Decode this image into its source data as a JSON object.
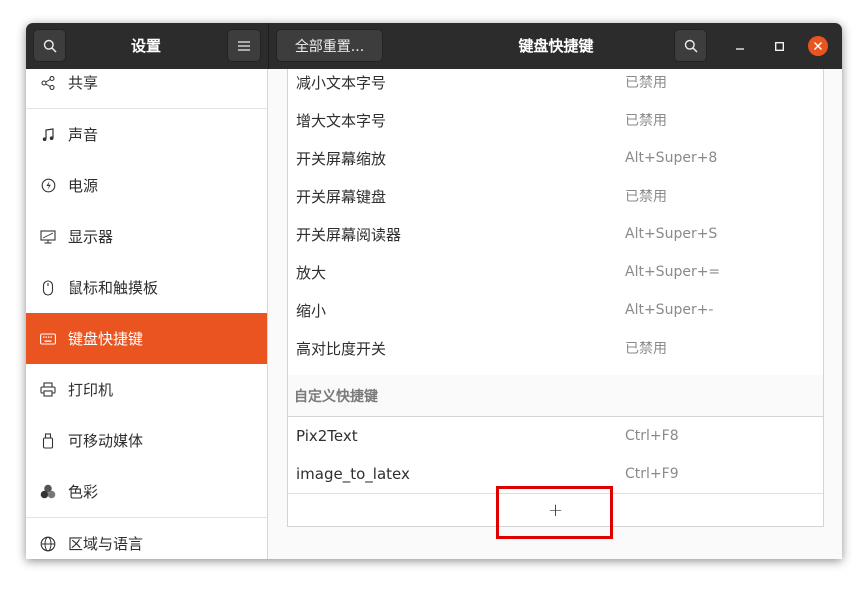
{
  "header": {
    "sidebar_title": "设置",
    "reset_button_label": "全部重置...",
    "page_title": "键盘快捷键"
  },
  "sidebar": {
    "items": [
      {
        "label": "共享",
        "icon": "share-icon"
      },
      {
        "label": "声音",
        "icon": "music-note-icon"
      },
      {
        "label": "电源",
        "icon": "power-icon"
      },
      {
        "label": "显示器",
        "icon": "display-icon"
      },
      {
        "label": "鼠标和触摸板",
        "icon": "mouse-icon"
      },
      {
        "label": "键盘快捷键",
        "icon": "keyboard-icon",
        "active": true
      },
      {
        "label": "打印机",
        "icon": "printer-icon"
      },
      {
        "label": "可移动媒体",
        "icon": "removable-media-icon"
      },
      {
        "label": "色彩",
        "icon": "color-icon"
      },
      {
        "label": "区域与语言",
        "icon": "globe-icon"
      }
    ]
  },
  "shortcuts": {
    "rows": [
      {
        "name": "减小文本字号",
        "accel": "已禁用"
      },
      {
        "name": "增大文本字号",
        "accel": "已禁用"
      },
      {
        "name": "开关屏幕缩放",
        "accel": "Alt+Super+8"
      },
      {
        "name": "开关屏幕键盘",
        "accel": "已禁用"
      },
      {
        "name": "开关屏幕阅读器",
        "accel": "Alt+Super+S"
      },
      {
        "name": "放大",
        "accel": "Alt+Super+="
      },
      {
        "name": "缩小",
        "accel": "Alt+Super+-"
      },
      {
        "name": "高对比度开关",
        "accel": "已禁用"
      }
    ],
    "custom_section_title": "自定义快捷键",
    "custom_rows": [
      {
        "name": "Pix2Text",
        "accel": "Ctrl+F8"
      },
      {
        "name": "image_to_latex",
        "accel": "Ctrl+F9"
      }
    ],
    "add_button_symbol": "+"
  },
  "colors": {
    "accent": "#e95420",
    "titlebar": "#2c2c2c",
    "close_button": "#e95420",
    "highlight_box": "#e00000"
  }
}
